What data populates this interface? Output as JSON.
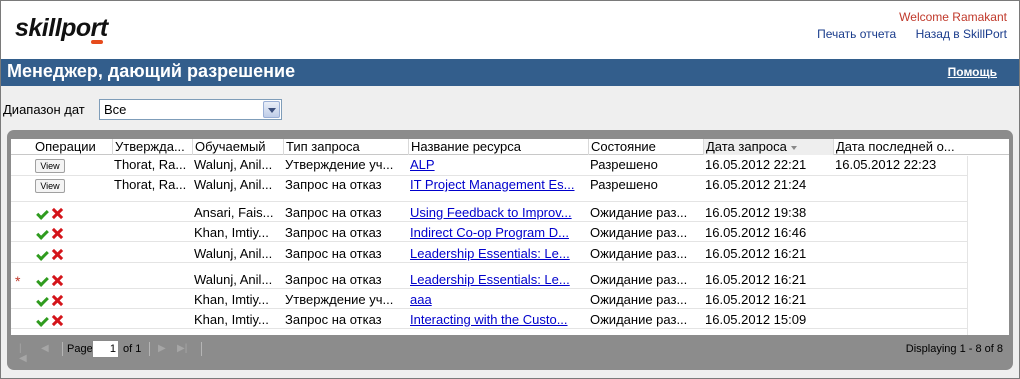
{
  "header": {
    "logo": "skillport",
    "welcome": "Welcome Ramakant",
    "links": [
      "Печать отчета",
      "Назад в SkillPort"
    ]
  },
  "titlebar": {
    "title": "Менеджер, дающий разрешение",
    "help": "Помощь"
  },
  "filter": {
    "label": "Диапазон дат",
    "value": "Все"
  },
  "grid": {
    "columns": [
      "Операции",
      "Утвержда...",
      "Обучаемый",
      "Тип запроса",
      "Название ресурса",
      "Состояние",
      "Дата запроса",
      "Дата последней о..."
    ],
    "rows": [
      {
        "op": "View",
        "approver": "Thorat, Ra...",
        "learner": "Walunj, Anil...",
        "type": "Утверждение уч...",
        "resource": "ALP",
        "state": "Разрешено",
        "requested": "16.05.2012 22:21",
        "last": "16.05.2012 22:23"
      },
      {
        "op": "View",
        "approver": "Thorat, Ra...",
        "learner": "Walunj, Anil...",
        "type": "Запрос на отказ",
        "resource": "IT Project Management Es...",
        "state": "Разрешено",
        "requested": "16.05.2012 21:24",
        "last": ""
      },
      {
        "op": "actions",
        "approver": "",
        "learner": "Ansari, Fais...",
        "type": "Запрос на отказ",
        "resource": "Using Feedback to Improv...",
        "state": "Ожидание раз...",
        "requested": "16.05.2012 19:38",
        "last": ""
      },
      {
        "op": "actions",
        "approver": "",
        "learner": "Khan, Imtiy...",
        "type": "Запрос на отказ",
        "resource": "Indirect Co-op Program D...",
        "state": "Ожидание раз...",
        "requested": "16.05.2012 16:46",
        "last": ""
      },
      {
        "op": "actions",
        "approver": "",
        "learner": "Walunj, Anil...",
        "type": "Запрос на отказ",
        "resource": "Leadership Essentials: Le...",
        "state": "Ожидание раз...",
        "requested": "16.05.2012 16:21",
        "last": ""
      },
      {
        "op": "actions",
        "approver": "",
        "learner": "Walunj, Anil...",
        "type": "Запрос на отказ",
        "resource": "Leadership Essentials: Le...",
        "state": "Ожидание раз...",
        "requested": "16.05.2012 16:21",
        "last": "",
        "marker": "*"
      },
      {
        "op": "actions",
        "approver": "",
        "learner": "Khan, Imtiy...",
        "type": "Утверждение уч...",
        "resource": "aaa",
        "state": "Ожидание раз...",
        "requested": "16.05.2012 16:21",
        "last": ""
      },
      {
        "op": "actions",
        "approver": "",
        "learner": "Khan, Imtiy...",
        "type": "Запрос на отказ",
        "resource": "Interacting with the Custo...",
        "state": "Ожидание раз...",
        "requested": "16.05.2012 15:09",
        "last": ""
      }
    ]
  },
  "pager": {
    "page_label": "Page",
    "page_value": "1",
    "of_label": "of 1",
    "display_text": "Displaying 1 - 8 of 8"
  },
  "colors": {
    "titlebar": "#335e8c",
    "welcome": "#c0392b",
    "link": "#0000cc",
    "approve": "#2f9b1e",
    "reject": "#d4141a"
  },
  "icons": [
    "approve-check-icon",
    "reject-x-icon",
    "first-page-icon",
    "prev-page-icon",
    "next-page-icon",
    "last-page-icon",
    "dropdown-arrow-icon"
  ]
}
